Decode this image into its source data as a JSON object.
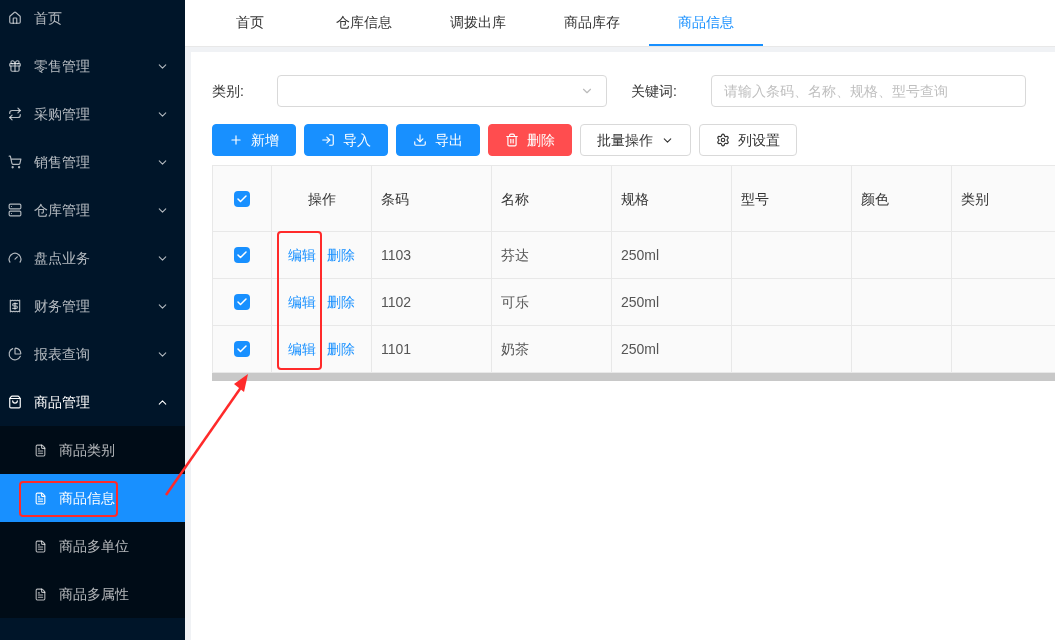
{
  "sidebar": {
    "items": [
      {
        "label": "首页",
        "kind": "link",
        "expanded": false
      },
      {
        "label": "零售管理",
        "kind": "menu",
        "expanded": false
      },
      {
        "label": "采购管理",
        "kind": "menu",
        "expanded": false
      },
      {
        "label": "销售管理",
        "kind": "menu",
        "expanded": false
      },
      {
        "label": "仓库管理",
        "kind": "menu",
        "expanded": false
      },
      {
        "label": "盘点业务",
        "kind": "menu",
        "expanded": false
      },
      {
        "label": "财务管理",
        "kind": "menu",
        "expanded": false
      },
      {
        "label": "报表查询",
        "kind": "menu",
        "expanded": false
      },
      {
        "label": "商品管理",
        "kind": "menu",
        "expanded": true,
        "children": [
          {
            "label": "商品类别",
            "selected": false
          },
          {
            "label": "商品信息",
            "selected": true
          },
          {
            "label": "商品多单位",
            "selected": false
          },
          {
            "label": "商品多属性",
            "selected": false
          }
        ]
      }
    ]
  },
  "tabs": [
    {
      "label": "首页",
      "selected": false
    },
    {
      "label": "仓库信息",
      "selected": false
    },
    {
      "label": "调拨出库",
      "selected": false
    },
    {
      "label": "商品库存",
      "selected": false
    },
    {
      "label": "商品信息",
      "selected": true
    }
  ],
  "filters": [
    {
      "label": "类别:",
      "kind": "select"
    },
    {
      "label": "关键词:",
      "kind": "input",
      "placeholder": "请输入条码、名称、规格、型号查询"
    }
  ],
  "toolbar": [
    {
      "label": "新增",
      "kind": "primary"
    },
    {
      "label": "导入",
      "kind": "primary"
    },
    {
      "label": "导出",
      "kind": "primary"
    },
    {
      "label": "删除",
      "kind": "danger"
    },
    {
      "label": "批量操作",
      "kind": "dropdown"
    },
    {
      "label": "列设置",
      "kind": "default"
    }
  ],
  "table": {
    "all_checked": true,
    "action_column": "操作",
    "columns": [
      "条码",
      "名称",
      "规格",
      "型号",
      "颜色",
      "类别"
    ],
    "rows": [
      {
        "checked": true,
        "actions": [
          "编辑",
          "删除"
        ],
        "cells": [
          "1103",
          "芬达",
          "250ml",
          "",
          "",
          ""
        ]
      },
      {
        "checked": true,
        "actions": [
          "编辑",
          "删除"
        ],
        "cells": [
          "1102",
          "可乐",
          "250ml",
          "",
          "",
          ""
        ]
      },
      {
        "checked": true,
        "actions": [
          "编辑",
          "删除"
        ],
        "cells": [
          "1101",
          "奶茶",
          "250ml",
          "",
          "",
          ""
        ]
      }
    ]
  }
}
